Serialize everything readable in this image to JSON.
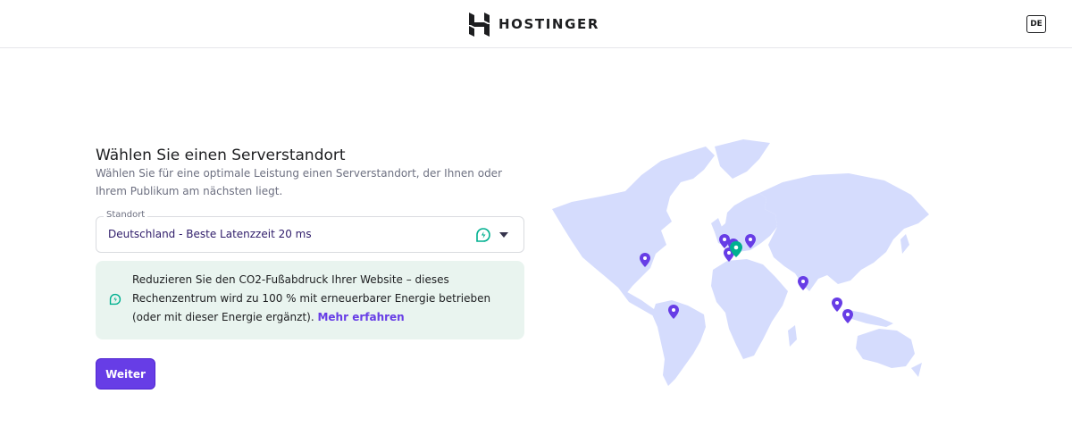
{
  "header": {
    "brand": "HOSTINGER",
    "logo_icon": "hostinger-logo-icon",
    "language_button": "DE"
  },
  "main": {
    "title": "Wählen Sie einen Serverstandort",
    "subtitle": "Wählen Sie für eine optimale Leistung einen Serverstandort, der Ihnen oder Ihrem Publikum am nächsten liegt.",
    "location_select": {
      "label": "Standort",
      "value": "Deutschland - Beste Latenzzeit 20 ms",
      "badge_icon": "leaf-icon",
      "caret_icon": "caret-down-icon"
    },
    "eco_notice": {
      "icon": "leaf-icon",
      "text": "Reduzieren Sie den CO2-Fußabdruck Ihrer Website – dieses Rechenzentrum wird zu 100 % mit erneuerbarer Energie betrieben (oder mit dieser Energie ergänzt). ",
      "link": "Mehr erfahren"
    },
    "continue_button": "Weiter"
  },
  "map": {
    "land_color": "#d5dcfd",
    "pin_color": "#673de6",
    "selected_pin_color": "#00b090",
    "pins": [
      "usa",
      "brazil",
      "uk",
      "netherlands",
      "germany",
      "france",
      "lithuania",
      "india",
      "malaysia",
      "indonesia"
    ],
    "selected_pin": "germany"
  },
  "colors": {
    "accent": "#673de6",
    "eco_background": "#e9f4ef",
    "eco_green": "#00b090"
  }
}
